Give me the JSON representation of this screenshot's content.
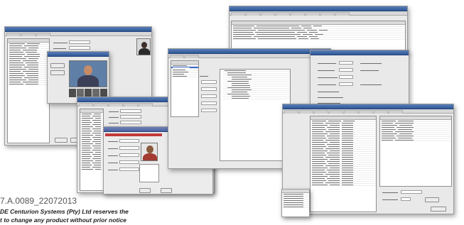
{
  "caption": {
    "code": "7.A.0089_22072013",
    "line1": "DE Centurion Systems (Pty) Ltd reserves the",
    "line2": "t to change any product without prior notice"
  }
}
